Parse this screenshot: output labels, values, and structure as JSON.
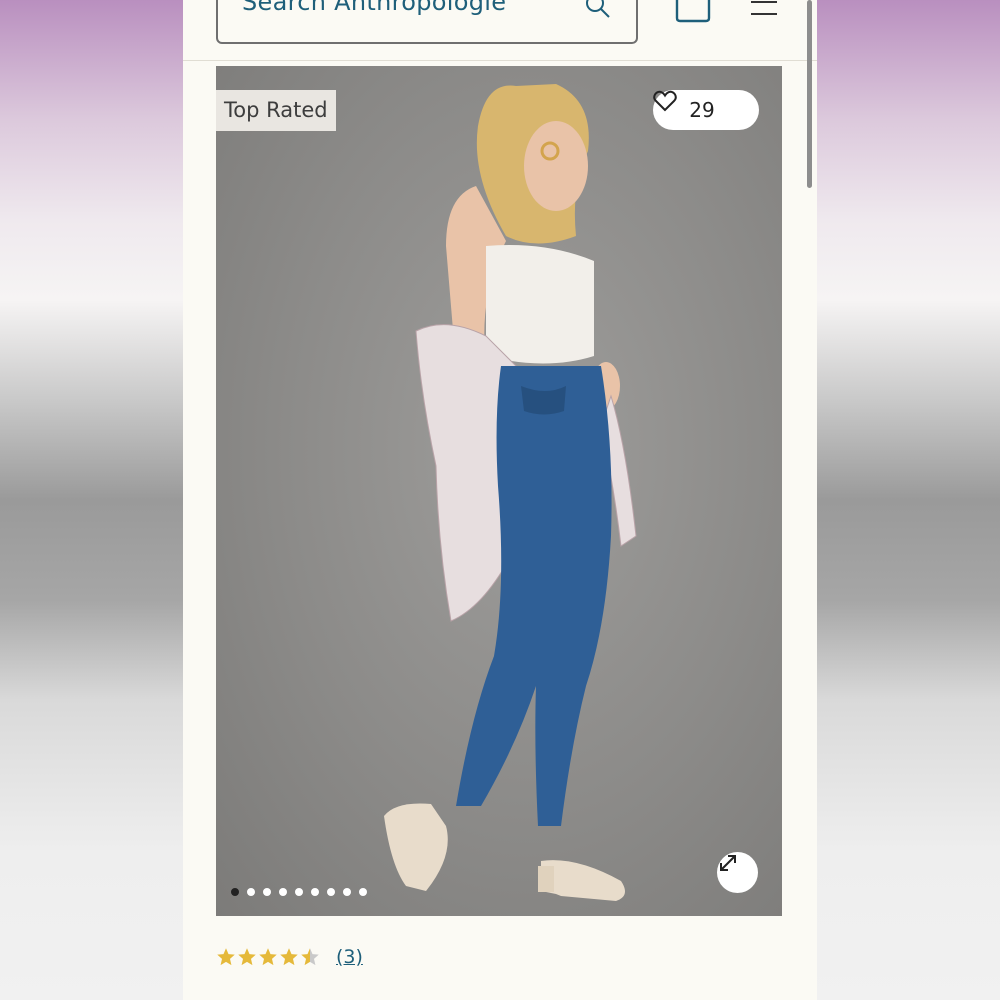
{
  "search": {
    "placeholder": "Search Anthropologie"
  },
  "header": {
    "search_icon": "search-icon",
    "bag_icon": "shopping-bag-icon",
    "menu_icon": "hamburger-menu-icon"
  },
  "product": {
    "badge": "Top Rated",
    "favorites_count": "29",
    "image_count": 9,
    "active_image": 1
  },
  "review": {
    "rating": 4.5,
    "max_rating": 5,
    "count_label": "(3)"
  },
  "colors": {
    "accent": "#1e5f7a",
    "star": "#e5b93a",
    "background": "#fbfaf4"
  }
}
